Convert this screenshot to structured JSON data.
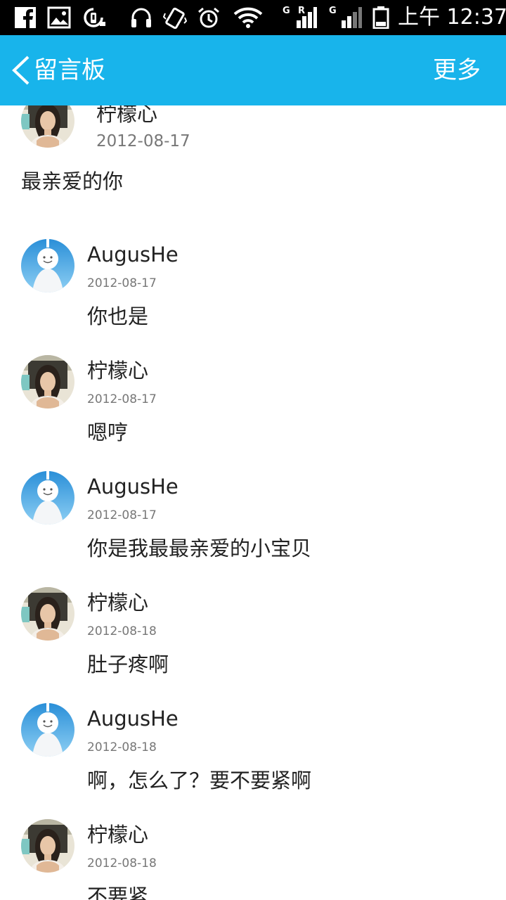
{
  "status_bar": {
    "icons": [
      "facebook-icon",
      "gallery-icon",
      "sync-icon",
      "headphones-icon",
      "vibrate-icon",
      "alarm-icon",
      "wifi-icon",
      "signal-icon",
      "signal-icon",
      "battery-icon"
    ],
    "carrier_1_top": "G",
    "carrier_1_sub": "R",
    "carrier_2": "G",
    "time": "上午 12:37"
  },
  "header": {
    "back_icon": "chevron-left-icon",
    "title": "留言板",
    "more_label": "更多",
    "background": "#18b4eb"
  },
  "main_post": {
    "author": "柠檬心",
    "date": "2012-08-17",
    "text": "最亲爱的你",
    "avatar": "girl-photo-avatar"
  },
  "replies": [
    {
      "author": "AugusHe",
      "date": "2012-08-17",
      "text": "你也是",
      "avatar": "doll-avatar"
    },
    {
      "author": "柠檬心",
      "date": "2012-08-17",
      "text": "嗯哼",
      "avatar": "girl-photo-avatar"
    },
    {
      "author": "AugusHe",
      "date": "2012-08-17",
      "text": "你是我最最亲爱的小宝贝",
      "avatar": "doll-avatar"
    },
    {
      "author": "柠檬心",
      "date": "2012-08-18",
      "text": "肚子疼啊",
      "avatar": "girl-photo-avatar"
    },
    {
      "author": "AugusHe",
      "date": "2012-08-18",
      "text": "啊，怎么了？要不要紧啊",
      "avatar": "doll-avatar"
    },
    {
      "author": "柠檬心",
      "date": "2012-08-18",
      "text": "不要紧",
      "avatar": "girl-photo-avatar"
    }
  ]
}
